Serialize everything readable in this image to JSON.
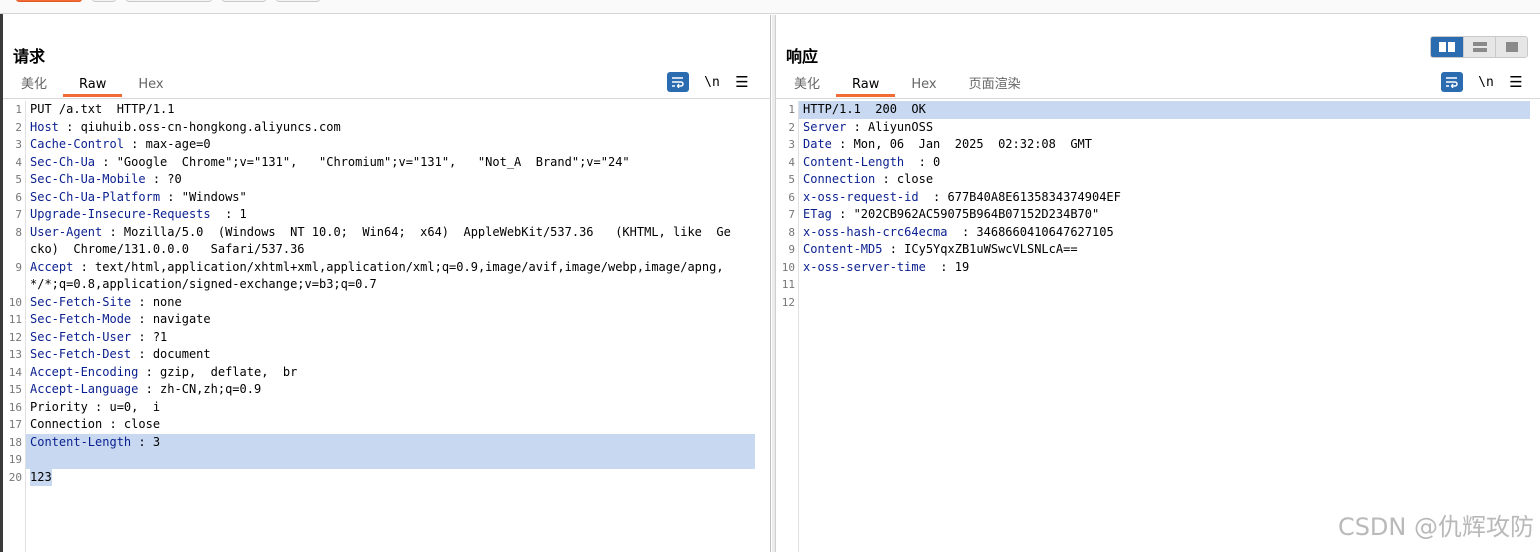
{
  "request": {
    "title": "请求",
    "tabs": [
      "美化",
      "Raw",
      "Hex"
    ],
    "active_tab": "Raw",
    "tools": {
      "newline": "\\n",
      "menu": "☰"
    },
    "lines": [
      {
        "n": "1",
        "name": "",
        "value": "PUT /a.txt  HTTP/1.1"
      },
      {
        "n": "2",
        "name": "Host",
        "value": " : qiuhuib.oss-cn-hongkong.aliyuncs.com"
      },
      {
        "n": "3",
        "name": "Cache-Control",
        "value": " : max-age=0"
      },
      {
        "n": "4",
        "name": "Sec-Ch-Ua",
        "value": " : \"Google  Chrome\";v=\"131\",   \"Chromium\";v=\"131\",   \"Not_A  Brand\";v=\"24\""
      },
      {
        "n": "5",
        "name": "Sec-Ch-Ua-Mobile",
        "value": " : ?0"
      },
      {
        "n": "6",
        "name": "Sec-Ch-Ua-Platform",
        "value": " : \"Windows\""
      },
      {
        "n": "7",
        "name": "Upgrade-Insecure-Requests",
        "value": "  : 1"
      },
      {
        "n": "8",
        "name": "User-Agent",
        "value": " : Mozilla/5.0  (Windows  NT 10.0;  Win64;  x64)  AppleWebKit/537.36   (KHTML, like  Gecko)  Chrome/131.0.0.0   Safari/537.36"
      },
      {
        "n": "9",
        "name": "Accept",
        "value": " : text/html,application/xhtml+xml,application/xml;q=0.9,image/avif,image/webp,image/apng,*/*;q=0.8,application/signed-exchange;v=b3;q=0.7"
      },
      {
        "n": "10",
        "name": "Sec-Fetch-Site",
        "value": " : none"
      },
      {
        "n": "11",
        "name": "Sec-Fetch-Mode",
        "value": " : navigate"
      },
      {
        "n": "12",
        "name": "Sec-Fetch-User",
        "value": " : ?1"
      },
      {
        "n": "13",
        "name": "Sec-Fetch-Dest",
        "value": " : document"
      },
      {
        "n": "14",
        "name": "Accept-Encoding",
        "value": " : gzip,  deflate,  br"
      },
      {
        "n": "15",
        "name": "Accept-Language",
        "value": " : zh-CN,zh;q=0.9"
      },
      {
        "n": "16",
        "name": "",
        "value": "Priority : u=0,  i"
      },
      {
        "n": "17",
        "name": "",
        "value": "Connection : close"
      },
      {
        "n": "18",
        "name": "Content-Length",
        "value": " : 3"
      },
      {
        "n": "19",
        "name": "",
        "value": ""
      },
      {
        "n": "20",
        "name": "",
        "value": "123"
      }
    ]
  },
  "response": {
    "title": "响应",
    "tabs": [
      "美化",
      "Raw",
      "Hex",
      "页面渲染"
    ],
    "active_tab": "Raw",
    "tools": {
      "newline": "\\n",
      "menu": "☰"
    },
    "lines": [
      {
        "n": "1",
        "name": "",
        "value": "HTTP/1.1  200  OK"
      },
      {
        "n": "2",
        "name": "Server",
        "value": " : AliyunOSS"
      },
      {
        "n": "3",
        "name": "Date",
        "value": " : Mon, 06  Jan  2025  02:32:08  GMT"
      },
      {
        "n": "4",
        "name": "Content-Length",
        "value": "  : 0"
      },
      {
        "n": "5",
        "name": "Connection",
        "value": " : close"
      },
      {
        "n": "6",
        "name": "x-oss-request-id",
        "value": "  : 677B40A8E6135834374904EF"
      },
      {
        "n": "7",
        "name": "ETag",
        "value": " : \"202CB962AC59075B964B07152D234B70\""
      },
      {
        "n": "8",
        "name": "x-oss-hash-crc64ecma",
        "value": "  : 3468660410647627105"
      },
      {
        "n": "9",
        "name": "Content-MD5",
        "value": " : ICy5YqxZB1uWSwcVLSNLcA=="
      },
      {
        "n": "10",
        "name": "x-oss-server-time",
        "value": "  : 19"
      },
      {
        "n": "11",
        "name": "",
        "value": ""
      },
      {
        "n": "12",
        "name": "",
        "value": ""
      }
    ]
  },
  "watermark": "CSDN @仇辉攻防",
  "colors": {
    "accent": "#f26b35",
    "header_name": "#0a1f8f",
    "selection": "#c7d8f0",
    "tool_blue": "#2b6cb0"
  }
}
